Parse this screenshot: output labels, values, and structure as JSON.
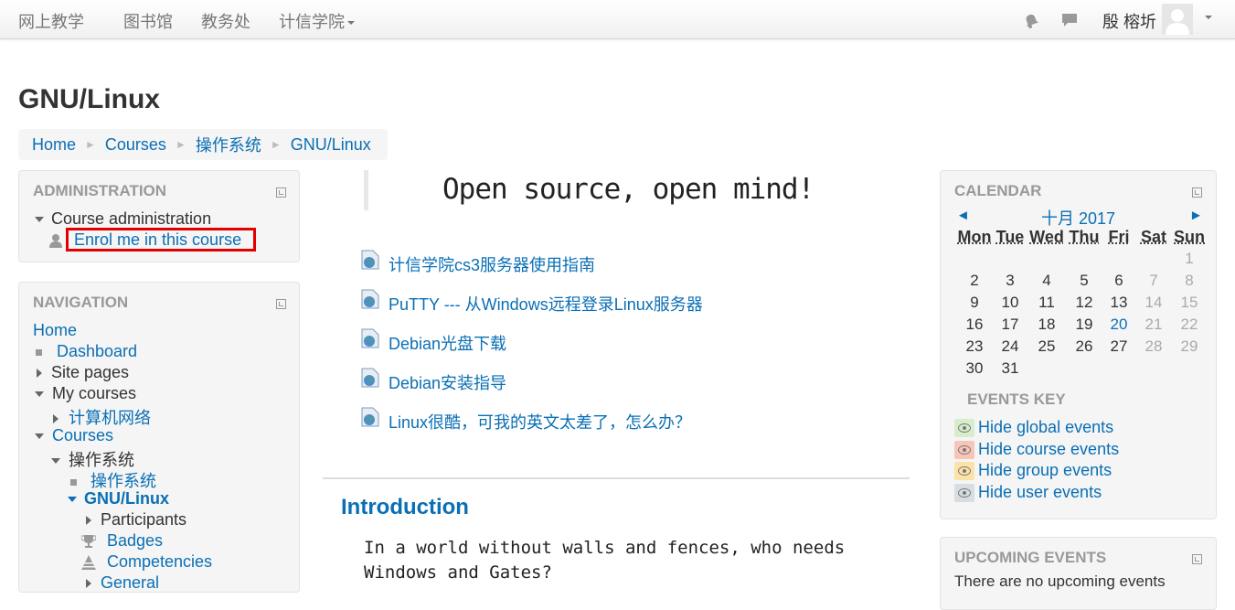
{
  "navbar": {
    "brand": "网上教学",
    "links": [
      "图书馆",
      "教务处",
      "计信学院"
    ],
    "username": "殷 榕圻"
  },
  "page": {
    "title": "GNU/Linux"
  },
  "breadcrumb": [
    "Home",
    "Courses",
    "操作系统",
    "GNU/Linux"
  ],
  "admin": {
    "title": "ADMINISTRATION",
    "course_admin": "Course administration",
    "enrol": "Enrol me in this course"
  },
  "nav": {
    "title": "NAVIGATION",
    "home": "Home",
    "dashboard": "Dashboard",
    "site_pages": "Site pages",
    "my_courses": "My courses",
    "network": "计算机网络",
    "courses": "Courses",
    "os": "操作系统",
    "os_link": "操作系统",
    "gnu": "GNU/Linux",
    "participants": "Participants",
    "badges": "Badges",
    "competencies": "Competencies",
    "general": "General"
  },
  "center": {
    "motto": "Open source, open mind!",
    "resources": [
      "计信学院cs3服务器使用指南",
      "PuTTY --- 从Windows远程登录Linux服务器",
      "Debian光盘下载",
      "Debian安装指导",
      "Linux很酷，可我的英文太差了，怎么办？"
    ],
    "intro_heading": "Introduction",
    "intro_line1": "In a world without walls and fences, who needs",
    "intro_line2": "Windows and Gates?"
  },
  "calendar": {
    "title": "CALENDAR",
    "prev": "◄",
    "next": "►",
    "month": "十月 2017",
    "days": [
      "Mon",
      "Tue",
      "Wed",
      "Thu",
      "Fri",
      "Sat",
      "Sun"
    ],
    "weeks": [
      [
        "",
        "",
        "",
        "",
        "",
        "",
        "1"
      ],
      [
        "2",
        "3",
        "4",
        "5",
        "6",
        "7",
        "8"
      ],
      [
        "9",
        "10",
        "11",
        "12",
        "13",
        "14",
        "15"
      ],
      [
        "16",
        "17",
        "18",
        "19",
        "20",
        "21",
        "22"
      ],
      [
        "23",
        "24",
        "25",
        "26",
        "27",
        "28",
        "29"
      ],
      [
        "30",
        "31",
        "",
        "",
        "",
        "",
        ""
      ]
    ],
    "today": "20",
    "events_key_title": "EVENTS KEY",
    "events_key": [
      {
        "label": "Hide global events",
        "color": "#d6eecb"
      },
      {
        "label": "Hide course events",
        "color": "#f6c6b8"
      },
      {
        "label": "Hide group events",
        "color": "#fbe2a8"
      },
      {
        "label": "Hide user events",
        "color": "#d8dde2"
      }
    ]
  },
  "upcoming": {
    "title": "UPCOMING EVENTS",
    "text": "There are no upcoming events"
  }
}
